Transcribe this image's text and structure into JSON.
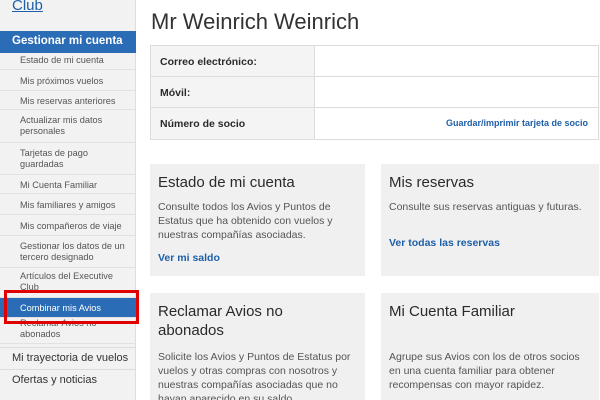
{
  "sidebar": {
    "club_link": "Club",
    "section_header": "Gestionar mi cuenta",
    "items": [
      {
        "label": "Estado de mi cuenta"
      },
      {
        "label": "Mis próximos vuelos"
      },
      {
        "label": "Mis reservas anteriores"
      },
      {
        "label": "Actualizar mis datos personales"
      },
      {
        "label": "Tarjetas de pago guardadas"
      },
      {
        "label": "Mi Cuenta Familiar"
      },
      {
        "label": "Mis familiares y amigos"
      },
      {
        "label": "Mis compañeros de viaje"
      },
      {
        "label": "Gestionar los datos de un tercero designado"
      },
      {
        "label": "Artículos del Executive Club"
      },
      {
        "label": "Combinar mis Avios"
      },
      {
        "label": "Reclamar Avios no abonados"
      }
    ],
    "outer_items": [
      {
        "label": "Mi trayectoria de vuelos"
      },
      {
        "label": "Ofertas y noticias"
      }
    ]
  },
  "main": {
    "title": "Mr Weinrich Weinrich",
    "info": {
      "email_label": "Correo electrónico:",
      "mobile_label": "Móvil:",
      "member_label": "Número de socio",
      "card_link": "Guardar/imprimir tarjeta de socio"
    },
    "cards": [
      {
        "title": "Estado de mi cuenta",
        "text": "Consulte todos los Avios y Puntos de Estatus que ha obtenido con vuelos y nuestras compañías asociadas.",
        "link": "Ver mi saldo"
      },
      {
        "title": "Mis reservas",
        "text": "Consulte sus reservas antiguas y futuras.",
        "link": "Ver todas las reservas"
      },
      {
        "title": "Reclamar Avios no abonados",
        "text": "Solicite los Avios y Puntos de Estatus por vuelos y otras compras con nosotros y nuestras compañías asociadas que no hayan aparecido en su saldo."
      },
      {
        "title": "Mi Cuenta Familiar",
        "text": "Agrupe sus Avios con los de otros socios en una cuenta familiar para obtener recompensas con mayor rapidez."
      }
    ]
  }
}
